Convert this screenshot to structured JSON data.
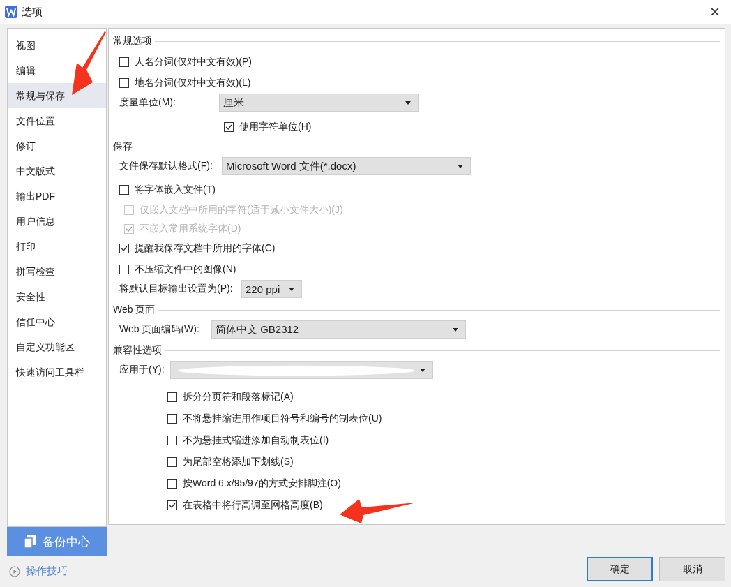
{
  "window": {
    "title": "选项",
    "close": "×"
  },
  "sidebar": {
    "items": [
      {
        "label": "视图",
        "selected": false
      },
      {
        "label": "编辑",
        "selected": false
      },
      {
        "label": "常规与保存",
        "selected": true
      },
      {
        "label": "文件位置",
        "selected": false
      },
      {
        "label": "修订",
        "selected": false
      },
      {
        "label": "中文版式",
        "selected": false
      },
      {
        "label": "输出PDF",
        "selected": false
      },
      {
        "label": "用户信息",
        "selected": false
      },
      {
        "label": "打印",
        "selected": false
      },
      {
        "label": "拼写检查",
        "selected": false
      },
      {
        "label": "安全性",
        "selected": false
      },
      {
        "label": "信任中心",
        "selected": false
      },
      {
        "label": "自定义功能区",
        "selected": false
      },
      {
        "label": "快速访问工具栏",
        "selected": false
      }
    ],
    "backup_button": "备份中心",
    "tips_link": "操作技巧"
  },
  "sections": [
    {
      "title": "常规选项",
      "items": [
        {
          "kind": "checkbox",
          "label": "人名分词(仅对中文有效)(P)",
          "checked": false,
          "disabled": false
        },
        {
          "kind": "checkbox",
          "label": "地名分词(仅对中文有效)(L)",
          "checked": false,
          "disabled": false
        },
        {
          "kind": "select",
          "label": "度量单位(M):",
          "value": "厘米",
          "children": [
            {
              "kind": "checkbox",
              "label": "使用字符单位(H)",
              "checked": true,
              "disabled": false
            }
          ]
        }
      ]
    },
    {
      "title": "保存",
      "items": [
        {
          "kind": "select",
          "label": "文件保存默认格式(F):",
          "value": "Microsoft Word 文件(*.docx)"
        },
        {
          "kind": "checkbox",
          "label": "将字体嵌入文件(T)",
          "checked": false,
          "disabled": false,
          "children": [
            {
              "kind": "checkbox",
              "label": "仅嵌入文档中所用的字符(适于减小文件大小)(J)",
              "checked": false,
              "disabled": true
            },
            {
              "kind": "checkbox",
              "label": "不嵌入常用系统字体(D)",
              "checked": true,
              "disabled": true
            }
          ]
        },
        {
          "kind": "checkbox",
          "label": "提醒我保存文档中所用的字体(C)",
          "checked": true,
          "disabled": false
        },
        {
          "kind": "checkbox",
          "label": "不压缩文件中的图像(N)",
          "checked": false,
          "disabled": false
        },
        {
          "kind": "select",
          "label": "将默认目标输出设置为(P):",
          "value": "220 ppi"
        }
      ]
    },
    {
      "title": "Web 页面",
      "items": [
        {
          "kind": "select",
          "label": "Web 页面编码(W):",
          "value": "简体中文 GB2312"
        }
      ]
    },
    {
      "title": "兼容性选项",
      "items": [
        {
          "kind": "select",
          "label": "应用于(Y):",
          "redacted": true,
          "children": [
            {
              "kind": "checkbox",
              "label": "拆分分页符和段落标记(A)",
              "checked": false,
              "disabled": false
            },
            {
              "kind": "checkbox",
              "label": "不将悬挂缩进用作项目符号和编号的制表位(U)",
              "checked": false,
              "disabled": false
            },
            {
              "kind": "checkbox",
              "label": "不为悬挂式缩进添加自动制表位(I)",
              "checked": false,
              "disabled": false
            },
            {
              "kind": "checkbox",
              "label": "为尾部空格添加下划线(S)",
              "checked": false,
              "disabled": false
            },
            {
              "kind": "checkbox",
              "label": "按Word 6.x/95/97的方式安排脚注(O)",
              "checked": false,
              "disabled": false
            },
            {
              "kind": "checkbox",
              "label": "在表格中将行高调至网格高度(B)",
              "checked": true,
              "disabled": false
            }
          ]
        }
      ]
    }
  ],
  "buttons": [
    {
      "label": "确定",
      "default": true
    },
    {
      "label": "取消",
      "default": false
    }
  ]
}
